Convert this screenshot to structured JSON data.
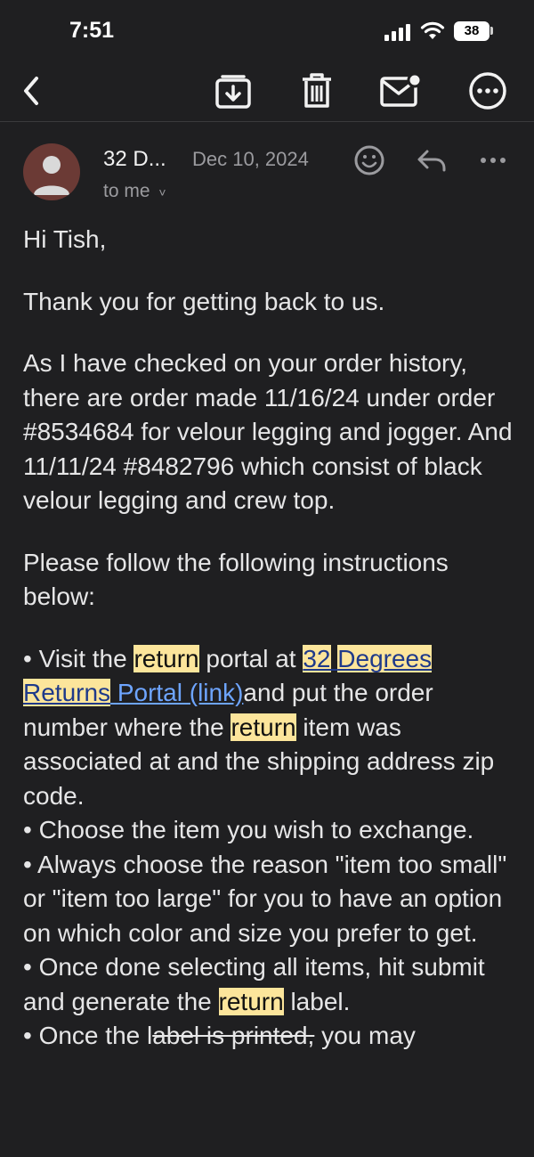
{
  "status": {
    "time": "7:51",
    "battery": "38"
  },
  "toolbar": {
    "back": "back-icon",
    "archive": "archive-icon",
    "delete": "trash-icon",
    "mark_unread": "mail-unread-icon",
    "more": "more-circle-icon"
  },
  "header": {
    "sender": "32 D...",
    "date": "Dec 10, 2024",
    "recipient": "to me",
    "recipient_caret": "˅"
  },
  "body": {
    "greeting": "Hi Tish,",
    "p1": "Thank you for getting back to us.",
    "p2": "As I have checked on your order history, there are order made 11/16/24 under order #8534684 for velour legging and jogger. And 11/11/24 #8482796 which consist of black velour legging and crew top.",
    "p3": "Please follow the following instructions below:",
    "b1": {
      "prefix": "• Visit the ",
      "hl1": "return",
      "mid": " portal at ",
      "link_hl_a": "32",
      "link_sep": " ",
      "link_hl_b": "Degrees Returns",
      "link_plain": " Portal (link)",
      "rest": "and put the order number where the ",
      "hl2": "return",
      "end": " item was associated at and the shipping address zip code."
    },
    "b2": "• Choose the item you wish to exchange.",
    "b3": "• Always choose the reason \"item too small\" or \"item too large\" for you to have an option on which color and size you prefer to get.",
    "b4": {
      "prefix": "• Once done selecting all items, hit submit and generate the ",
      "hl": "return",
      "end": " label."
    },
    "b5": {
      "prefix": "• Once the l",
      "strike": "abel is printed,",
      "end": " you may"
    }
  }
}
